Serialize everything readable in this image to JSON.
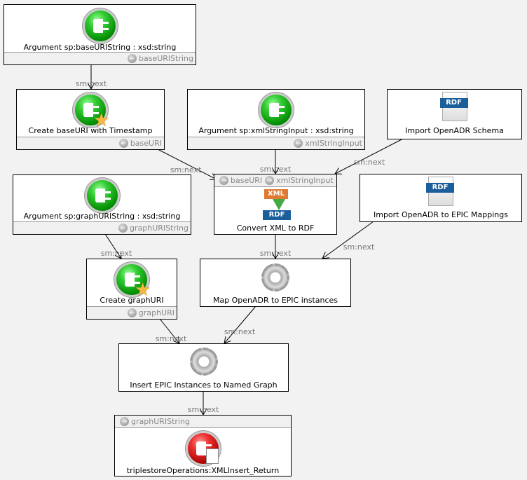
{
  "nodes": {
    "arg_base": {
      "title": "Argument sp:baseURIString : xsd:string",
      "port": "baseURIString",
      "icon": "argument-plug-icon"
    },
    "create_base": {
      "title": "Create baseURI with Timestamp",
      "port": "baseURI",
      "icon": "bind-plug-star-icon"
    },
    "arg_xml": {
      "title": "Argument sp:xmlStringInput : xsd:string",
      "port": "xmlStringInput",
      "icon": "argument-plug-icon"
    },
    "import_schema": {
      "title": "Import OpenADR Schema",
      "icon_text": "RDF",
      "icon": "rdf-document-icon"
    },
    "arg_graph": {
      "title": "Argument sp:graphURIString : xsd:string",
      "port": "graphURIString",
      "icon": "argument-plug-icon"
    },
    "convert": {
      "title": "Convert XML to RDF",
      "in_ports": [
        "baseURI",
        "xmlStringInput"
      ],
      "icon_top": "XML",
      "icon_bottom": "RDF",
      "icon": "xml-to-rdf-icon"
    },
    "import_mappings": {
      "title": "Import OpenADR to EPIC Mappings",
      "icon_text": "RDF",
      "icon": "rdf-document-icon"
    },
    "create_graph": {
      "title": "Create graphURI",
      "port": "graphURI",
      "icon": "bind-plug-star-icon"
    },
    "map": {
      "title": "Map OpenADR to EPIC instances",
      "icon": "gear-refresh-icon"
    },
    "insert": {
      "title": "Insert EPIC Instances to Named Graph",
      "icon": "gear-edit-icon"
    },
    "ret": {
      "title": "triplestoreOperations:XMLInsert_Return",
      "in_port": "graphURIString",
      "icon": "return-plug-icon"
    }
  },
  "edge_label": "sm:next"
}
